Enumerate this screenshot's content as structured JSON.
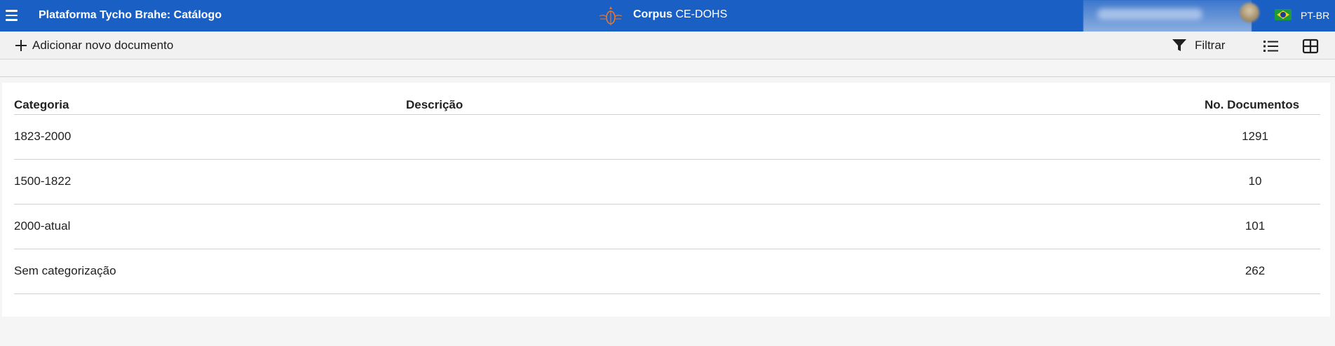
{
  "appbar": {
    "title": "Plataforma Tycho Brahe: Catálogo",
    "corpus_label": "Corpus",
    "corpus_name": "CE-DOHS",
    "language": "PT-BR"
  },
  "toolbar": {
    "add_label": "Adicionar novo documento",
    "filter_label": "Filtrar"
  },
  "table": {
    "headers": {
      "category": "Categoria",
      "description": "Descrição",
      "doc_count": "No. Documentos"
    },
    "rows": [
      {
        "category": "1823-2000",
        "description": "",
        "doc_count": "1291"
      },
      {
        "category": "1500-1822",
        "description": "",
        "doc_count": "10"
      },
      {
        "category": "2000-atual",
        "description": "",
        "doc_count": "101"
      },
      {
        "category": "Sem categorização",
        "description": "",
        "doc_count": "262"
      }
    ]
  },
  "colors": {
    "appbar": "#1a5fc4",
    "background": "#f5f5f5"
  },
  "icons": [
    "menu-icon",
    "corpus-logo",
    "flag-brazil-icon",
    "plus-icon",
    "filter-icon",
    "list-view-icon",
    "grid-view-icon"
  ]
}
